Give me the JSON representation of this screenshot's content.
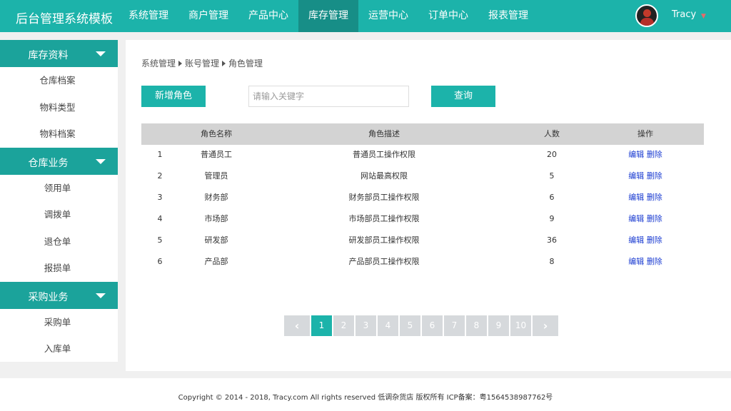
{
  "header": {
    "logo": "后台管理系统模板",
    "nav": [
      {
        "label": "系统管理"
      },
      {
        "label": "商户管理"
      },
      {
        "label": "产品中心"
      },
      {
        "label": "库存管理"
      },
      {
        "label": "运营中心"
      },
      {
        "label": "订单中心"
      },
      {
        "label": "报表管理"
      }
    ],
    "active_nav": "库存管理",
    "username": "Tracy",
    "caret_icon": "chevron-down-icon",
    "avatar_icon": "user-avatar"
  },
  "sidebar": {
    "groups": [
      {
        "title": "库存资料",
        "items": [
          "仓库档案",
          "物料类型",
          "物料档案"
        ]
      },
      {
        "title": "仓库业务",
        "items": [
          "领用单",
          "调拨单",
          "退仓单",
          "报损单"
        ]
      },
      {
        "title": "采购业务",
        "items": [
          "采购单",
          "入库单"
        ]
      }
    ]
  },
  "breadcrumb": [
    "系统管理",
    "账号管理",
    "角色管理"
  ],
  "toolbar": {
    "add_label": "新增角色",
    "search_placeholder": "请输入关键字",
    "search_value": "",
    "query_label": "查询"
  },
  "table": {
    "headers": [
      "",
      "角色名称",
      "角色描述",
      "人数",
      "操作"
    ],
    "rows": [
      {
        "idx": "1",
        "name": "普通员工",
        "desc": "普通员工操作权限",
        "count": "20"
      },
      {
        "idx": "2",
        "name": "管理员",
        "desc": "网站最高权限",
        "count": "5"
      },
      {
        "idx": "3",
        "name": "财务部",
        "desc": "财务部员工操作权限",
        "count": "6"
      },
      {
        "idx": "4",
        "name": "市场部",
        "desc": "市场部员工操作权限",
        "count": "9"
      },
      {
        "idx": "5",
        "name": "研发部",
        "desc": "研发部员工操作权限",
        "count": "36"
      },
      {
        "idx": "6",
        "name": "产品部",
        "desc": "产品部员工操作权限",
        "count": "8"
      }
    ],
    "edit_label": "编辑",
    "delete_label": "删除"
  },
  "pagination": {
    "prev": "‹",
    "next": "›",
    "pages": [
      "1",
      "2",
      "3",
      "4",
      "5",
      "6",
      "7",
      "8",
      "9",
      "10"
    ],
    "current": "1"
  },
  "colors": {
    "accent": "#1cb3aa",
    "sidebar_header": "#1ba39b",
    "active_nav": "#178e87",
    "link": "#1a3bd1"
  },
  "footer": {
    "text": "Copyright © 2014 - 2018, Tracy.com All rights reserved 低调杂货店 版权所有 ICP备案：粤1564538987762号"
  }
}
